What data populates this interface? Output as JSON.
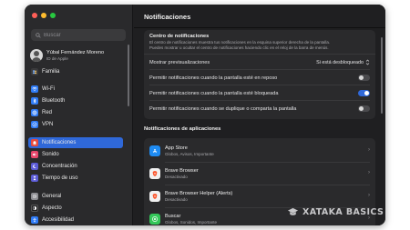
{
  "window": {
    "title": "Notificaciones",
    "traffic_colors": [
      "#ff5f57",
      "#febc2e",
      "#28c840"
    ]
  },
  "sidebar": {
    "search_placeholder": "Buscar",
    "user": {
      "name": "Yúbal Fernández Moreno",
      "subtitle": "ID de Apple"
    },
    "items": [
      {
        "label": "Familia",
        "icon": "family-icon",
        "color": "#3a3a3c"
      },
      {
        "label": "Wi-Fi",
        "icon": "wifi-icon",
        "color": "#2f7bf5"
      },
      {
        "label": "Bluetooth",
        "icon": "bluetooth-icon",
        "color": "#2f7bf5"
      },
      {
        "label": "Red",
        "icon": "globe-icon",
        "color": "#2f7bf5"
      },
      {
        "label": "VPN",
        "icon": "vpn-icon",
        "color": "#2f7bf5"
      },
      {
        "label": "Notificaciones",
        "icon": "bell-icon",
        "color": "#ea4b3c",
        "active": true
      },
      {
        "label": "Sonido",
        "icon": "speaker-icon",
        "color": "#e8466b"
      },
      {
        "label": "Concentración",
        "icon": "moon-icon",
        "color": "#5b5bd6"
      },
      {
        "label": "Tiempo de uso",
        "icon": "hourglass-icon",
        "color": "#5b5bd6"
      },
      {
        "label": "General",
        "icon": "gear-icon",
        "color": "#8e8e93"
      },
      {
        "label": "Aspecto",
        "icon": "appearance-icon",
        "color": "#1c1c1e"
      },
      {
        "label": "Accesibilidad",
        "icon": "accessibility-icon",
        "color": "#2f7bf5"
      }
    ]
  },
  "notification_center": {
    "title": "Centro de notificaciones",
    "description_line1": "El centro de notificaciones muestra tus notificaciones en la esquina superior derecha de la pantalla.",
    "description_line2": "Puedes mostrar u ocultar el centro de notificaciones haciendo clic en el reloj de la barra de menús.",
    "preview_label": "Mostrar previsualizaciones",
    "preview_value": "Si está desbloqueado",
    "toggles": [
      {
        "label": "Permitir notificaciones cuando la pantalla esté en reposo",
        "on": false
      },
      {
        "label": "Permitir notificaciones cuando la pantalla esté bloqueada",
        "on": true
      },
      {
        "label": "Permitir notificaciones cuando se duplique o comparta la pantalla",
        "on": false
      }
    ]
  },
  "app_notifications": {
    "title": "Notificaciones de aplicaciones",
    "apps": [
      {
        "name": "App Store",
        "detail": "Globos, Avisos, Importante",
        "icon": "app-store-icon",
        "color": "#1e8bf2"
      },
      {
        "name": "Brave Browser",
        "detail": "Desactivado",
        "icon": "brave-icon",
        "color": "#f1f1f1"
      },
      {
        "name": "Brave Browser Helper (Alerts)",
        "detail": "Desactivado",
        "icon": "brave-icon",
        "color": "#f1f1f1"
      },
      {
        "name": "Buscar",
        "detail": "Globos, Sonidos, Importante",
        "icon": "find-my-icon",
        "color": "#34c759"
      }
    ]
  },
  "watermark": {
    "text": "XATAKA BASICS"
  }
}
